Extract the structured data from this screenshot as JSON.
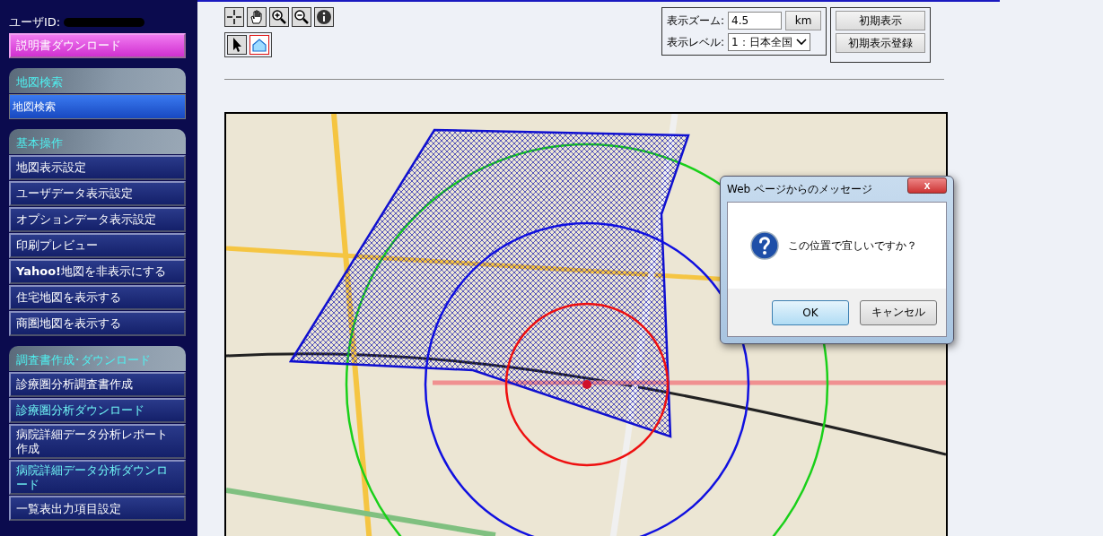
{
  "sidebar": {
    "user_label": "ユーザID:",
    "manual_button": "説明書ダウンロード",
    "sections": [
      {
        "title": "地図検索",
        "items": [
          {
            "label": "地図検索",
            "selected": true,
            "visited": false
          }
        ]
      },
      {
        "title": "基本操作",
        "items": [
          {
            "label": "地図表示設定",
            "selected": false,
            "visited": false
          },
          {
            "label": "ユーザデータ表示設定",
            "selected": false,
            "visited": false
          },
          {
            "label": "オプションデータ表示設定",
            "selected": false,
            "visited": false
          },
          {
            "label": "印刷プレビュー",
            "selected": false,
            "visited": false
          },
          {
            "label": "**Yahoo!**地図を非表示にする",
            "selected": false,
            "visited": false
          },
          {
            "label": "住宅地図を表示する",
            "selected": false,
            "visited": false
          },
          {
            "label": "商圏地図を表示する",
            "selected": false,
            "visited": false
          }
        ]
      },
      {
        "title": "調査書作成･ダウンロード",
        "items": [
          {
            "label": "診療圏分析調査書作成",
            "selected": false,
            "visited": false
          },
          {
            "label": "診療圏分析ダウンロード",
            "selected": false,
            "visited": true
          },
          {
            "label": "病院詳細データ分析レポート作成",
            "selected": false,
            "visited": false
          },
          {
            "label": "病院詳細データ分析ダウンロード",
            "selected": false,
            "visited": true
          },
          {
            "label": "一覧表出力項目設定",
            "selected": false,
            "visited": false
          }
        ]
      }
    ]
  },
  "toolbar": {
    "map_tools": [
      {
        "kind": "crosshair",
        "selected": false
      },
      {
        "kind": "pan",
        "selected": false
      },
      {
        "kind": "zoom-in",
        "selected": false
      },
      {
        "kind": "zoom-out",
        "selected": false
      },
      {
        "kind": "info",
        "selected": false
      }
    ],
    "draw_tools": [
      {
        "kind": "pointer",
        "selected": false
      },
      {
        "kind": "polygon",
        "selected": true
      }
    ],
    "zoom_label": "表示ズーム:",
    "zoom_value": "4.5",
    "zoom_unit_button": "km",
    "level_label": "表示レベル:",
    "level_value": "1：日本全国",
    "buttons": [
      "初期表示",
      "初期表示登録"
    ]
  },
  "dialog": {
    "title": "Web ページからのメッセージ",
    "close": "x",
    "message": "この位置で宜しいですか？",
    "buttons": [
      "OK",
      "キャンセル"
    ]
  }
}
